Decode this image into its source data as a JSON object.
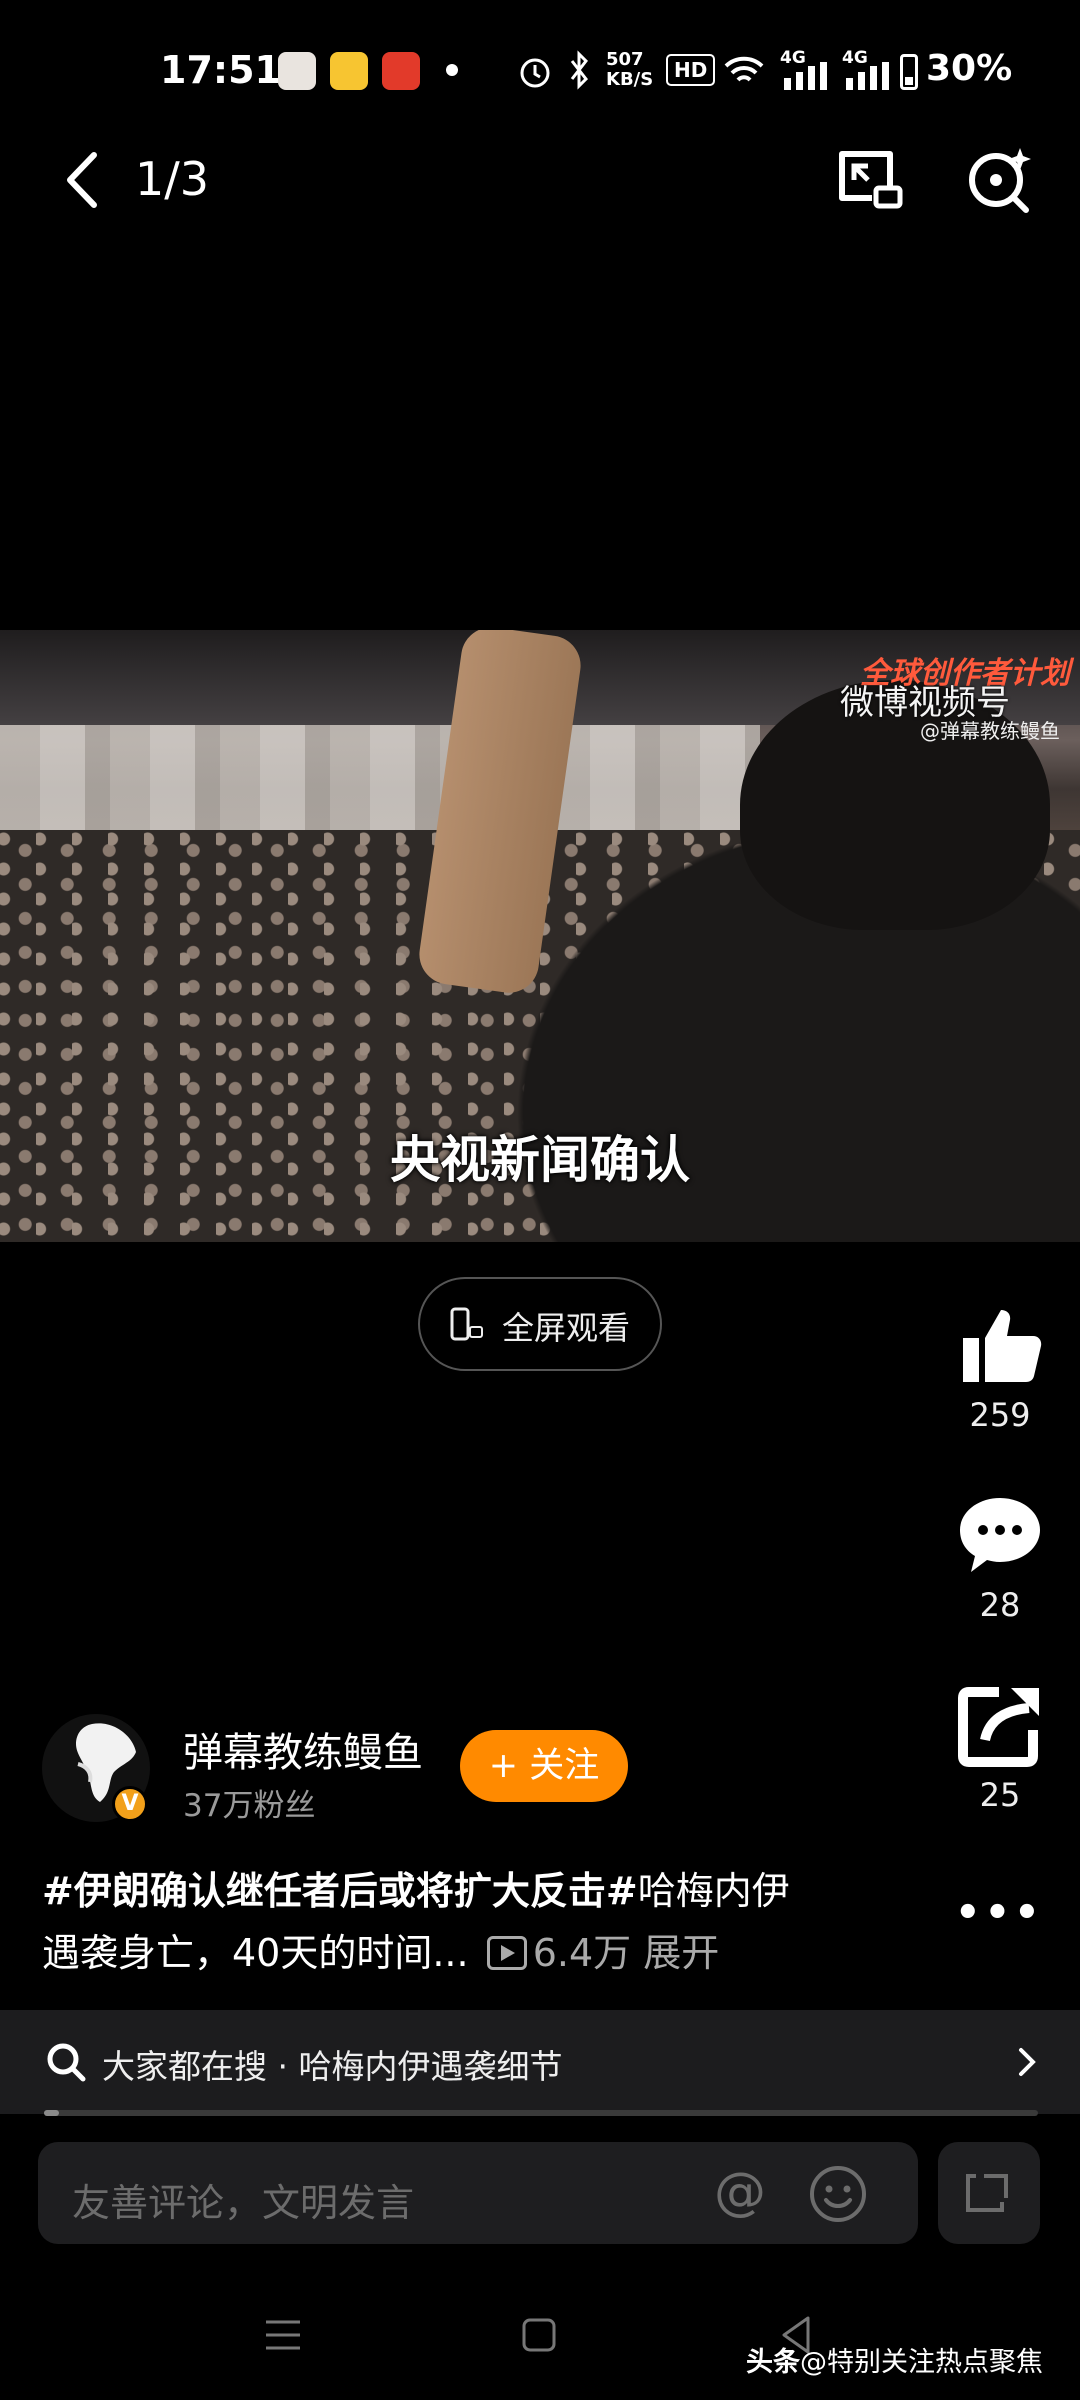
{
  "status_bar": {
    "time": "17:51",
    "network_speed": "507\nKB/S",
    "hd_badge": "HD",
    "signal_1": "4G",
    "signal_2": "4G",
    "battery": "30%",
    "icons": [
      "app-avatar-icon",
      "weibo-icon",
      "app-grid-icon",
      "dot-icon",
      "alarm-icon",
      "bluetooth-icon",
      "wifi-icon",
      "signal-icon",
      "battery-icon"
    ]
  },
  "header": {
    "page_indicator": "1/3",
    "icons": [
      "back-icon",
      "picture-in-picture-icon",
      "magic-search-icon"
    ]
  },
  "video": {
    "caption": "央视新闻确认",
    "watermark_logo": "微博视频号",
    "watermark_badge": "全球创作者计划",
    "watermark_user": "@弹幕教练鳗鱼"
  },
  "fullscreen": {
    "label": "全屏观看"
  },
  "actions": {
    "like_count": "259",
    "comment_count": "28",
    "share_count": "25",
    "more": "•••"
  },
  "author": {
    "name": "弹幕教练鳗鱼",
    "fans": "37万粉丝",
    "follow_label": "+ 关注",
    "verified_mark": "V"
  },
  "post": {
    "hashtag": "#伊朗确认继任者后或将扩大反击#",
    "text": "哈梅内伊遇袭身亡，40天的时间...",
    "views": "6.4万",
    "expand_label": "展开"
  },
  "search": {
    "text": "大家都在搜 · 哈梅内伊遇袭细节",
    "progress": 0.015
  },
  "comment": {
    "placeholder": "友善评论，文明发言",
    "at_symbol": "@"
  },
  "watermark": {
    "brand": "头条",
    "handle": "@特别关注热点聚焦"
  },
  "colors": {
    "background": "#000000",
    "follow_button": "#ff8a00",
    "verified": "#f2a01a",
    "search_bar": "#1c1c1e"
  }
}
